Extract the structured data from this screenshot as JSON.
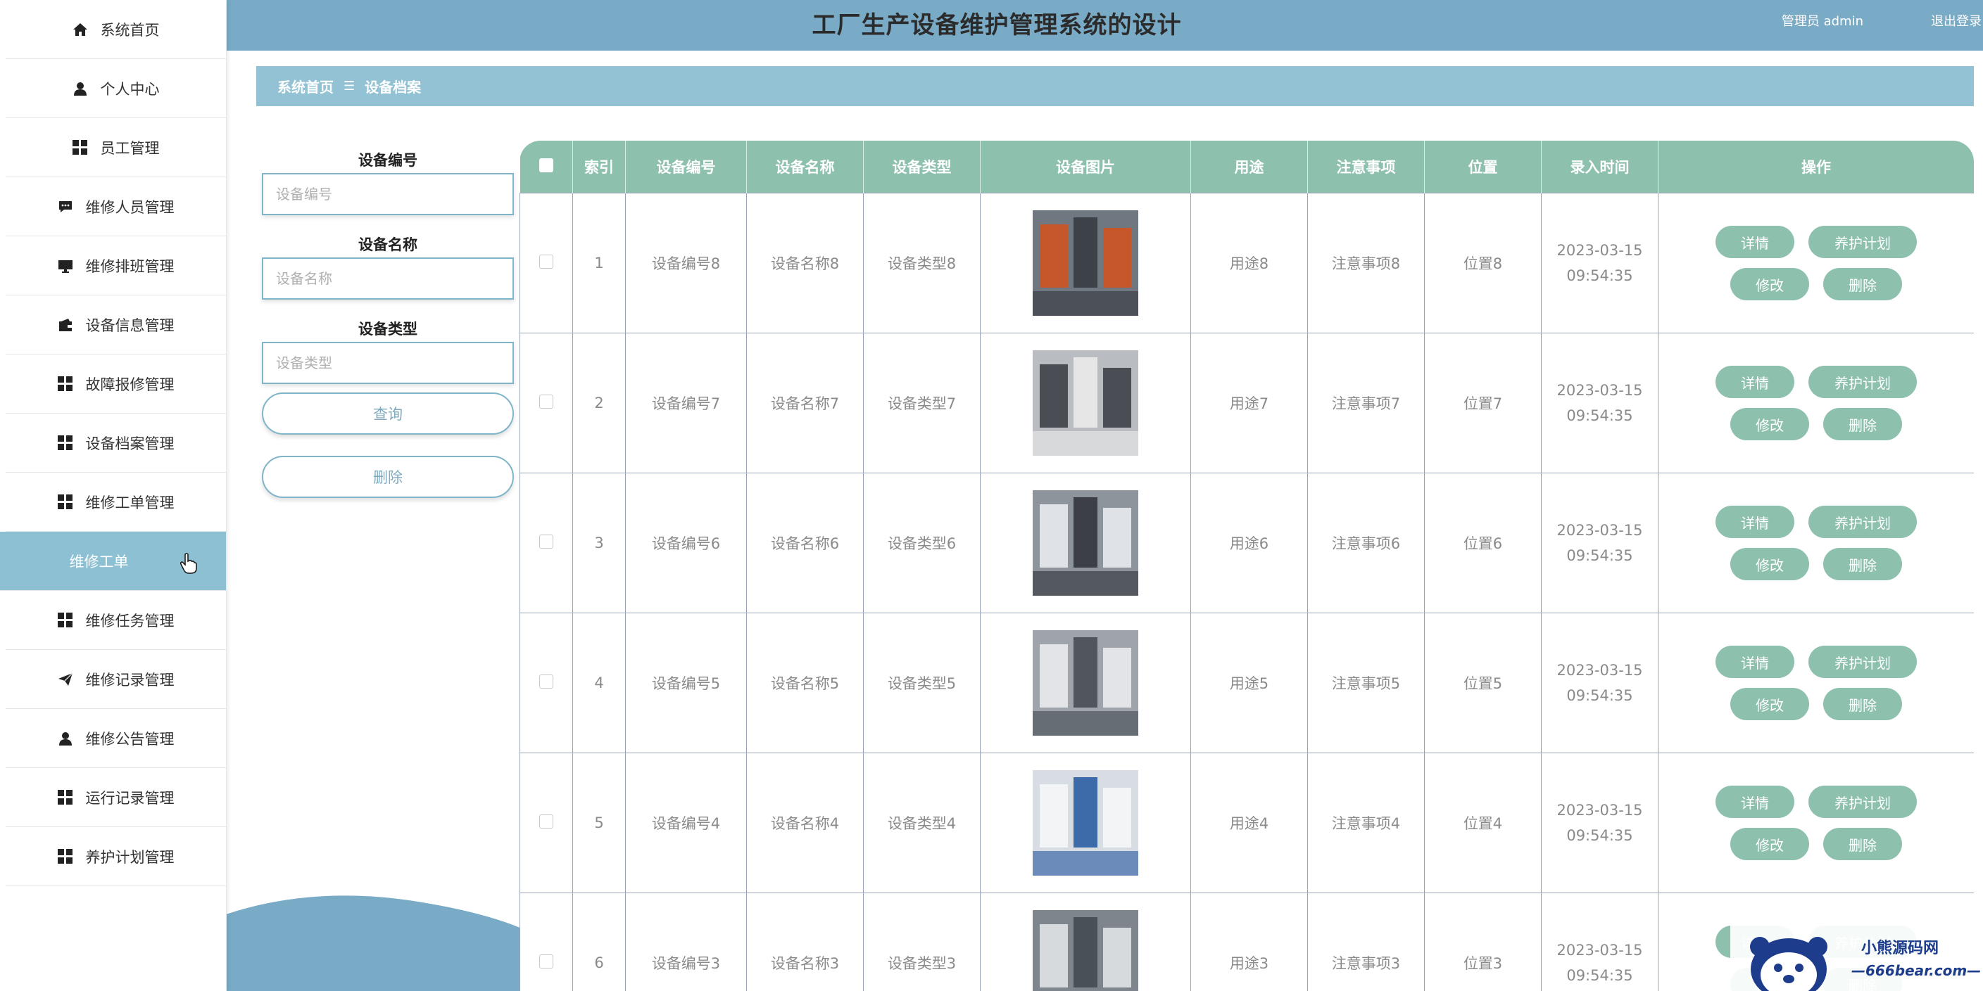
{
  "header": {
    "title": "工厂生产设备维护管理系统的设计",
    "user": "管理员 admin",
    "logout": "退出登录"
  },
  "sidebar": {
    "items": [
      {
        "label": "系统首页",
        "icon": "home-icon"
      },
      {
        "label": "个人中心",
        "icon": "user-icon"
      },
      {
        "label": "员工管理",
        "icon": "grid-icon"
      },
      {
        "label": "维修人员管理",
        "icon": "chat-icon"
      },
      {
        "label": "维修排班管理",
        "icon": "monitor-icon"
      },
      {
        "label": "设备信息管理",
        "icon": "wallet-icon"
      },
      {
        "label": "故障报修管理",
        "icon": "grid-icon"
      },
      {
        "label": "设备档案管理",
        "icon": "grid-icon"
      },
      {
        "label": "维修工单管理",
        "icon": "grid-icon"
      },
      {
        "label": "维修工单",
        "icon": "",
        "sub": true
      },
      {
        "label": "维修任务管理",
        "icon": "grid-icon"
      },
      {
        "label": "维修记录管理",
        "icon": "send-icon"
      },
      {
        "label": "维修公告管理",
        "icon": "user-icon"
      },
      {
        "label": "运行记录管理",
        "icon": "grid-icon"
      },
      {
        "label": "养护计划管理",
        "icon": "grid-icon"
      }
    ]
  },
  "breadcrumb": {
    "home": "系统首页",
    "sep": "☰",
    "current": "设备档案"
  },
  "search": {
    "fields": [
      {
        "label": "设备编号",
        "placeholder": "设备编号"
      },
      {
        "label": "设备名称",
        "placeholder": "设备名称"
      },
      {
        "label": "设备类型",
        "placeholder": "设备类型"
      }
    ],
    "query_label": "查询",
    "delete_label": "删除"
  },
  "table": {
    "headers": [
      "索引",
      "设备编号",
      "设备名称",
      "设备类型",
      "设备图片",
      "用途",
      "注意事项",
      "位置",
      "录入时间",
      "操作"
    ],
    "actions": {
      "detail": "详情",
      "plan": "养护计划",
      "edit": "修改",
      "delete": "删除"
    },
    "rows": [
      {
        "index": "1",
        "code": "设备编号8",
        "name": "设备名称8",
        "type": "设备类型8",
        "usage": "用途8",
        "note": "注意事项8",
        "location": "位置8",
        "date": "2023-03-15",
        "time": "09:54:35"
      },
      {
        "index": "2",
        "code": "设备编号7",
        "name": "设备名称7",
        "type": "设备类型7",
        "usage": "用途7",
        "note": "注意事项7",
        "location": "位置7",
        "date": "2023-03-15",
        "time": "09:54:35"
      },
      {
        "index": "3",
        "code": "设备编号6",
        "name": "设备名称6",
        "type": "设备类型6",
        "usage": "用途6",
        "note": "注意事项6",
        "location": "位置6",
        "date": "2023-03-15",
        "time": "09:54:35"
      },
      {
        "index": "4",
        "code": "设备编号5",
        "name": "设备名称5",
        "type": "设备类型5",
        "usage": "用途5",
        "note": "注意事项5",
        "location": "位置5",
        "date": "2023-03-15",
        "time": "09:54:35"
      },
      {
        "index": "5",
        "code": "设备编号4",
        "name": "设备名称4",
        "type": "设备类型4",
        "usage": "用途4",
        "note": "注意事项4",
        "location": "位置4",
        "date": "2023-03-15",
        "time": "09:54:35"
      },
      {
        "index": "6",
        "code": "设备编号3",
        "name": "设备名称3",
        "type": "设备类型3",
        "usage": "用途3",
        "note": "注意事项3",
        "location": "位置3",
        "date": "2023-03-15",
        "time": "09:54:35"
      }
    ]
  },
  "watermark": {
    "name": "小熊源码网",
    "url": "—666bear.com—"
  },
  "colors": {
    "header": "#79aac6",
    "breadcrumb": "#92c2d3",
    "table_header": "#8ec0ae",
    "active_menu": "#8ec0d4"
  }
}
